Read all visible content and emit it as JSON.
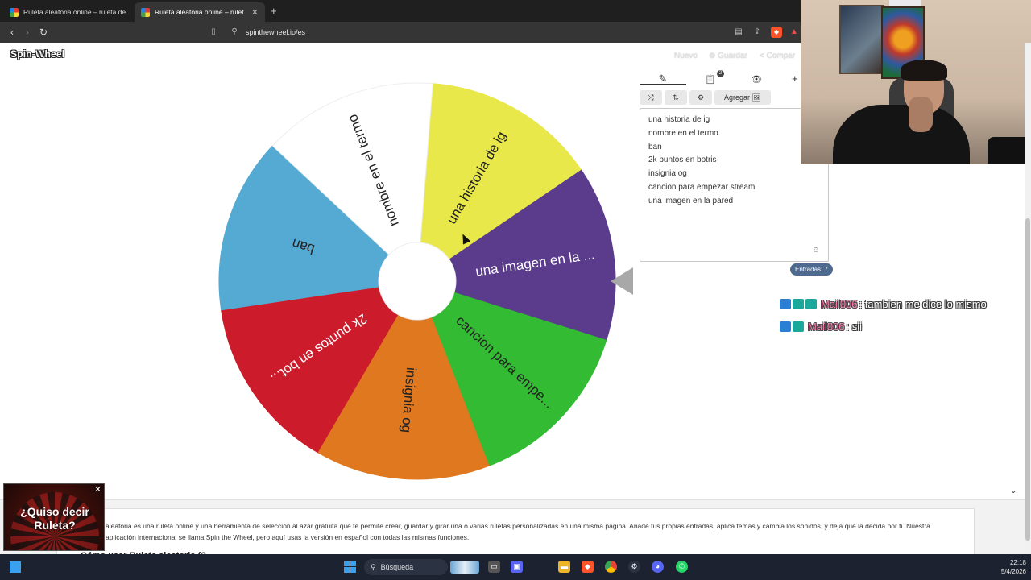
{
  "browser": {
    "tabs": [
      {
        "title": "Ruleta aleatoria online – ruleta de la s",
        "active": false
      },
      {
        "title": "Ruleta aleatoria online – rulet",
        "active": true
      }
    ],
    "new_tab": "+",
    "url": "spinthewheel.io/es"
  },
  "app": {
    "logo": "Spin-Wheel",
    "header_links": {
      "new": "Nuevo",
      "save": "Guardar",
      "share": "Compar"
    }
  },
  "wheel": {
    "slices": [
      {
        "label": "una historia de ig",
        "color": "#e8e84a"
      },
      {
        "label": "una imagen en la ...",
        "color": "#5b3c8c"
      },
      {
        "label": "cancion para empe...",
        "color": "#33bb33"
      },
      {
        "label": "insignia og",
        "color": "#e07820"
      },
      {
        "label": "2k puntos en bot...",
        "color": "#cc1c2c"
      },
      {
        "label": "ban",
        "color": "#55aad3"
      },
      {
        "label": "nombre en el termo",
        "color": "#ffffff"
      }
    ],
    "pointer_color": "#a8a8a8"
  },
  "editor": {
    "tabs": [
      {
        "icon": "pencil-icon",
        "glyph": "✎"
      },
      {
        "icon": "clipboard-icon",
        "glyph": "📋",
        "badge": "2"
      },
      {
        "icon": "eye-off-icon",
        "glyph": "👁"
      }
    ],
    "plus": "+",
    "toolbar": {
      "shuffle": "⤮",
      "sort": "⇅",
      "settings": "⚙",
      "add_label": "Agregar 🖼"
    },
    "entries": [
      "una historia de ig",
      "nombre en el termo",
      "ban",
      "2k puntos en botris",
      "insignia og",
      "cancion para empezar stream",
      "una imagen en la pared"
    ],
    "emoji": "☺",
    "count": "Entradas: 7"
  },
  "chat": [
    {
      "user": "Mail006",
      "message": ": tambien me dice lo mismo"
    },
    {
      "user": "Mail006",
      "message": ": sii"
    }
  ],
  "article": {
    "text": "aleatoria es una ruleta online y una herramienta de selección al azar gratuita que te permite crear, guardar y girar una o varias ruletas personalizadas en una misma página. Añade tus propias entradas, aplica temas y cambia los sonidos, y deja que la decida por ti. Nuestra aplicación internacional se llama Spin the Wheel, pero aquí usas la versión en español con todas las mismas funciones.",
    "heading": "Cómo usar Ruleta aleatoria (?",
    "chevron": "⌄"
  },
  "popup": {
    "text_line1": "¿Quiso decir",
    "text_line2": "Ruleta?",
    "close": "✕"
  },
  "taskbar": {
    "search": "Búsqueda",
    "time": "22:18",
    "date": "5/4/2026"
  }
}
